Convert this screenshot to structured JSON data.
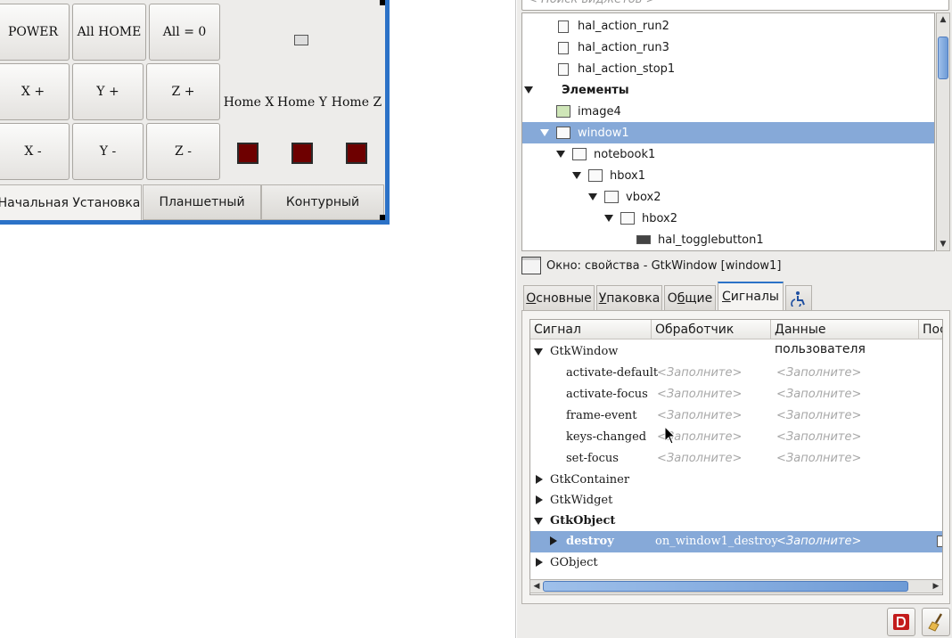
{
  "preview": {
    "buttons": {
      "power": "POWER",
      "all_home": "All HOME",
      "all_zero": "All = 0",
      "x_plus": "X +",
      "y_plus": "Y +",
      "z_plus": "Z +",
      "x_minus": "X -",
      "y_minus": "Y -",
      "z_minus": "Z -"
    },
    "home_labels": [
      "Home X",
      "Home Y",
      "Home Z"
    ],
    "tabs": [
      "Начальная Установка",
      "Планшетный",
      "Контурный"
    ],
    "led_color": "#6e0000",
    "selection_color": "#2c72c7"
  },
  "search": {
    "placeholder": "< Поиск виджетов >"
  },
  "tree": {
    "rows": [
      {
        "label": "hal_action_run2",
        "icon": "hal-action-icon"
      },
      {
        "label": "hal_action_run3",
        "icon": "hal-action-icon"
      },
      {
        "label": "hal_action_stop1",
        "icon": "hal-action-icon"
      },
      {
        "label": "Элементы",
        "bold": true
      },
      {
        "label": "image4",
        "icon": "image-icon"
      },
      {
        "label": "window1",
        "icon": "window-icon",
        "selected": true
      },
      {
        "label": "notebook1",
        "icon": "notebook-icon"
      },
      {
        "label": "hbox1",
        "icon": "hbox-icon"
      },
      {
        "label": "vbox2",
        "icon": "vbox-icon"
      },
      {
        "label": "hbox2",
        "icon": "hbox-icon"
      },
      {
        "label": "hal_togglebutton1",
        "icon": "togglebutton-icon"
      }
    ]
  },
  "properties": {
    "header": "Окно: свойства - GtkWindow [window1]",
    "tabs": [
      {
        "pre": "",
        "u": "О",
        "post": "сновные"
      },
      {
        "pre": "",
        "u": "У",
        "post": "паковка"
      },
      {
        "pre": "О",
        "u": "б",
        "post": "щие"
      },
      {
        "pre": "",
        "u": "С",
        "post": "игналы"
      }
    ],
    "active_tab": "Сигналы"
  },
  "signals": {
    "columns": [
      "Сигнал",
      "Обработчик",
      "Данные пользователя",
      "Пос"
    ],
    "placeholder": "<Заполните>",
    "rows": [
      {
        "group": "GtkWindow",
        "expanded": true
      },
      {
        "signal": "activate-default",
        "handler": "<Заполните>",
        "user_data": "<Заполните>"
      },
      {
        "signal": "activate-focus",
        "handler": "<Заполните>",
        "user_data": "<Заполните>"
      },
      {
        "signal": "frame-event",
        "handler": "<Заполните>",
        "user_data": "<Заполните>"
      },
      {
        "signal": "keys-changed",
        "handler": "<Заполните>",
        "user_data": "<Заполните>"
      },
      {
        "signal": "set-focus",
        "handler": "<Заполните>",
        "user_data": "<Заполните>"
      },
      {
        "group": "GtkContainer",
        "expanded": false
      },
      {
        "group": "GtkWidget",
        "expanded": false
      },
      {
        "group": "GtkObject",
        "expanded": true,
        "bold": true
      },
      {
        "signal": "destroy",
        "handler": "on_window1_destroy",
        "user_data": "<Заполните>",
        "selected": true
      },
      {
        "group": "GObject",
        "expanded": false
      }
    ]
  },
  "colors": {
    "selection": "#86a9d8",
    "accent": "#2c72c7"
  }
}
